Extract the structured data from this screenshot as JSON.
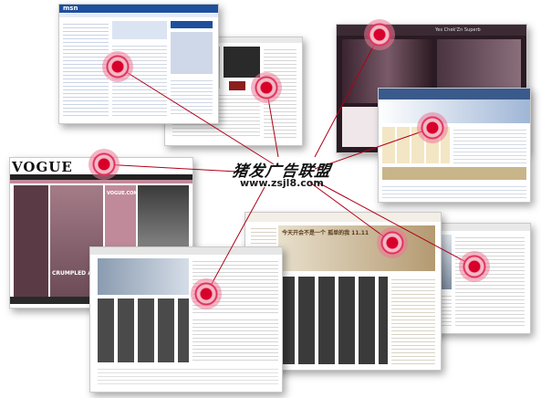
{
  "center": {
    "title": "猪发广告联盟",
    "url": "www.zsjl8.com"
  },
  "screens": {
    "msn": {
      "logo": "msn"
    },
    "vogue": {
      "logo": "VOGUE",
      "headline": "CRUMPLED AND",
      "side": "VOGUE.COM"
    },
    "music": {
      "banner_text": "Yes Chek'Zn Superb"
    },
    "bottom_center": {
      "banner_text": "今天开会不是一个 孤单的我 11.11"
    }
  },
  "colors": {
    "pulse": "#d8002a",
    "vogue_pink": "#c08a9a",
    "music_dark": "#2a1a24",
    "blue_band": "#3a5a8c"
  }
}
